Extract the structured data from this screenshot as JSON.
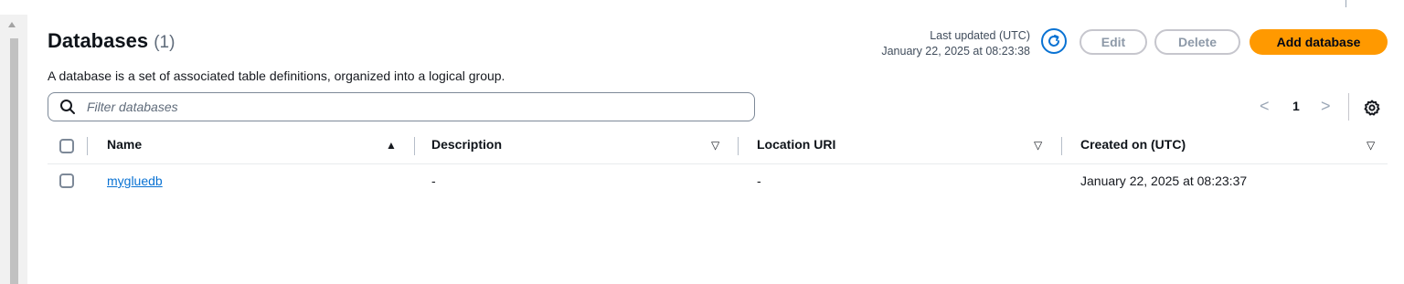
{
  "header": {
    "title": "Databases",
    "count": "(1)",
    "description": "A database is a set of associated table definitions, organized into a logical group.",
    "last_updated_label": "Last updated (UTC)",
    "last_updated_value": "January 22, 2025 at 08:23:38"
  },
  "actions": {
    "edit_label": "Edit",
    "delete_label": "Delete",
    "add_label": "Add database"
  },
  "filter": {
    "placeholder": "Filter databases"
  },
  "pagination": {
    "prev": "<",
    "current_page": "1",
    "next": ">"
  },
  "table": {
    "columns": [
      {
        "label": "Name",
        "sort": "▲"
      },
      {
        "label": "Description",
        "sort": "▽"
      },
      {
        "label": "Location URI",
        "sort": "▽"
      },
      {
        "label": "Created on (UTC)",
        "sort": "▽"
      }
    ],
    "rows": [
      {
        "name": "mygluedb",
        "description": "-",
        "location_uri": "-",
        "created_on": "January 22, 2025 at 08:23:37"
      }
    ]
  },
  "colors": {
    "accent": "#0972d3",
    "primary_button": "#ff9900",
    "disabled_border": "#c6c6cd"
  },
  "icons": [
    "refresh-icon",
    "search-icon",
    "settings-icon",
    "scroll-up-arrow"
  ]
}
